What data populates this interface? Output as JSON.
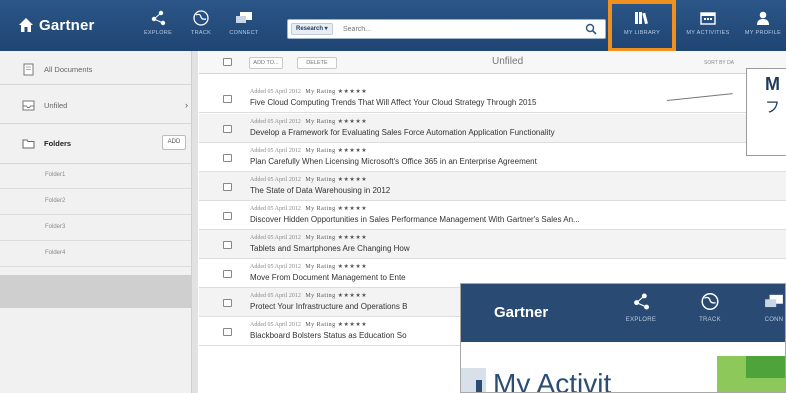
{
  "brand": {
    "name": "Gartner"
  },
  "nav": {
    "items": [
      {
        "label": "EXPLORE",
        "icon": "explore-icon"
      },
      {
        "label": "TRACK",
        "icon": "globe-icon"
      },
      {
        "label": "CONNECT",
        "icon": "chat-icon"
      },
      {
        "label": "MY LIBRARY",
        "icon": "library-icon"
      },
      {
        "label": "MY ACTIVITIES",
        "icon": "calendar-icon"
      },
      {
        "label": "MY PROFILE",
        "icon": "person-icon"
      }
    ],
    "search": {
      "scope_label": "Research ▾",
      "placeholder": "Search...",
      "value": ""
    }
  },
  "sidebar": {
    "all_documents": "All Documents",
    "unfiled": "Unfiled",
    "folders_label": "Folders",
    "add_label": "ADD",
    "folders": [
      "Folder1",
      "Folder2",
      "Folder3",
      "Folder4"
    ]
  },
  "list": {
    "add_to": "ADD TO...",
    "delete": "DELETE",
    "title": "Unfiled",
    "sort": "SORT BY DA",
    "documents": [
      {
        "added": "Added 05 April 2012",
        "rating": "My Rating ★★★★★",
        "title": "Five Cloud Computing Trends That Will Affect Your Cloud Strategy Through 2015"
      },
      {
        "added": "Added 05 April 2012",
        "rating": "My Rating ★★★★★",
        "title": "Develop a Framework for Evaluating Sales Force Automation Application Functionality"
      },
      {
        "added": "Added 05 April 2012",
        "rating": "My Rating ★★★★★",
        "title": "Plan Carefully When Licensing Microsoft's Office 365 in an Enterprise Agreement"
      },
      {
        "added": "Added 05 April 2012",
        "rating": "My Rating ★★★★★",
        "title": "The State of Data Warehousing in 2012"
      },
      {
        "added": "Added 05 April 2012",
        "rating": "My Rating ★★★★★",
        "title": "Discover Hidden Opportunities in Sales Performance Management With Gartner's Sales An..."
      },
      {
        "added": "Added 05 April 2012",
        "rating": "My Rating ★★★★★",
        "title": "Tablets and Smartphones Are Changing How"
      },
      {
        "added": "Added 05 April 2012",
        "rating": "My Rating ★★★★★",
        "title": "Move From Document Management to Ente"
      },
      {
        "added": "Added 05 April 2012",
        "rating": "My Rating ★★★★★",
        "title": "Protect Your Infrastructure and Operations B"
      },
      {
        "added": "Added 05 April 2012",
        "rating": "My Rating ★★★★★",
        "title": "Blackboard Bolsters Status as Education So"
      }
    ]
  },
  "callout": {
    "line1": "M",
    "line2": "フ"
  },
  "overlay": {
    "logo": "Gartner",
    "nav": [
      "EXPLORE",
      "TRACK",
      "CONN"
    ],
    "heading": "My Activit"
  },
  "colors": {
    "nav_bg": "#1f4573",
    "highlight": "#f0901f",
    "sidebar_bg": "#f1f1f1"
  }
}
